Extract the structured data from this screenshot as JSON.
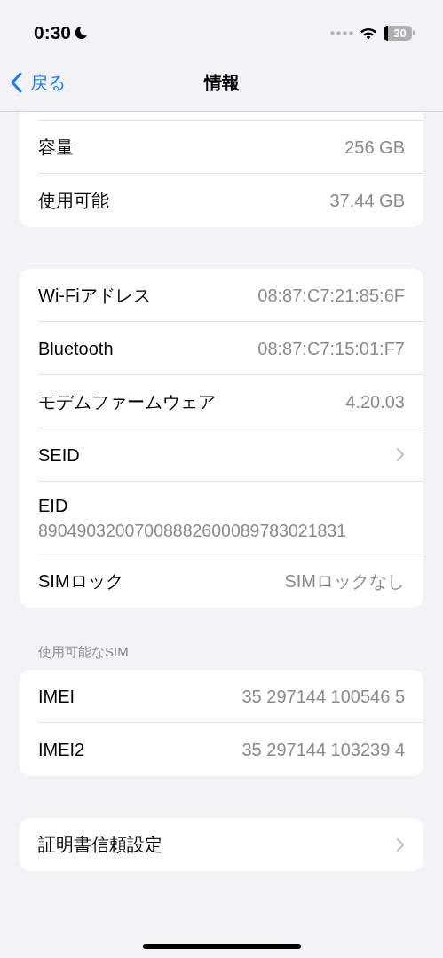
{
  "status_bar": {
    "time": "0:30",
    "battery": "30"
  },
  "nav": {
    "back": "戻る",
    "title": "情報"
  },
  "sections": [
    {
      "rows": [
        {
          "kind": "value",
          "label": "容量",
          "value": "256 GB"
        },
        {
          "kind": "value",
          "label": "使用可能",
          "value": "37.44 GB"
        }
      ]
    },
    {
      "rows": [
        {
          "kind": "value",
          "label": "Wi-Fiアドレス",
          "value": "08:87:C7:21:85:6F"
        },
        {
          "kind": "value",
          "label": "Bluetooth",
          "value": "08:87:C7:15:01:F7"
        },
        {
          "kind": "value",
          "label": "モデムファームウェア",
          "value": "4.20.03"
        },
        {
          "kind": "link",
          "label": "SEID"
        },
        {
          "kind": "stacked",
          "label": "EID",
          "value": "89049032007008882600089783021831"
        },
        {
          "kind": "value",
          "label": "SIMロック",
          "value": "SIMロックなし"
        }
      ]
    },
    {
      "header": "使用可能なSIM",
      "rows": [
        {
          "kind": "value",
          "label": "IMEI",
          "value": "35 297144 100546 5"
        },
        {
          "kind": "value",
          "label": "IMEI2",
          "value": "35 297144 103239 4"
        }
      ]
    },
    {
      "rows": [
        {
          "kind": "link",
          "label": "証明書信頼設定"
        }
      ]
    }
  ]
}
